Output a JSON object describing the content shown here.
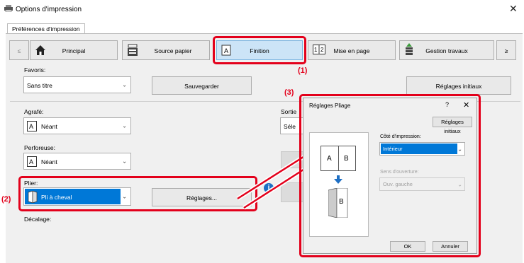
{
  "window": {
    "title": "Options d'impression",
    "close_icon": "close-icon"
  },
  "tab": {
    "label": "Préférences d'impression"
  },
  "nav": {
    "prev": "≤",
    "next": "≥",
    "items": [
      {
        "label": "Principal",
        "icon": "home-icon"
      },
      {
        "label": "Source papier",
        "icon": "paper-tray-icon"
      },
      {
        "label": "Finition",
        "icon": "finishing-icon"
      },
      {
        "label": "Mise en page",
        "icon": "layout-icon"
      },
      {
        "label": "Gestion travaux",
        "icon": "job-handling-icon"
      }
    ]
  },
  "favorites": {
    "label": "Favoris:",
    "value": "Sans titre",
    "save_label": "Sauvegarder",
    "reset_label": "Réglages initiaux"
  },
  "staple": {
    "label": "Agrafé:",
    "value": "Néant"
  },
  "punch": {
    "label": "Perforeuse:",
    "value": "Néant"
  },
  "fold": {
    "label": "Plier:",
    "value": "Pli à cheval",
    "settings_label": "Réglages..."
  },
  "offset": {
    "label": "Décalage:"
  },
  "output": {
    "label": "Sortie",
    "value": "Séle"
  },
  "callouts": {
    "c1": "(1)",
    "c2": "(2)",
    "c3": "(3)"
  },
  "dialog": {
    "title": "Réglages Pliage",
    "help": "?",
    "close": "✕",
    "reset_label": "Réglages initiaux",
    "print_side_label": "Côté d'impression:",
    "print_side_value": "Intérieur",
    "opening_label": "Sens d'ouverture:",
    "opening_value": "Ouv. gauche",
    "preview_a": "A",
    "preview_b": "B",
    "preview_b2": "B",
    "ok_label": "OK",
    "cancel_label": "Annuler"
  },
  "colors": {
    "accent": "#0078d7",
    "callout": "#e3001b"
  }
}
